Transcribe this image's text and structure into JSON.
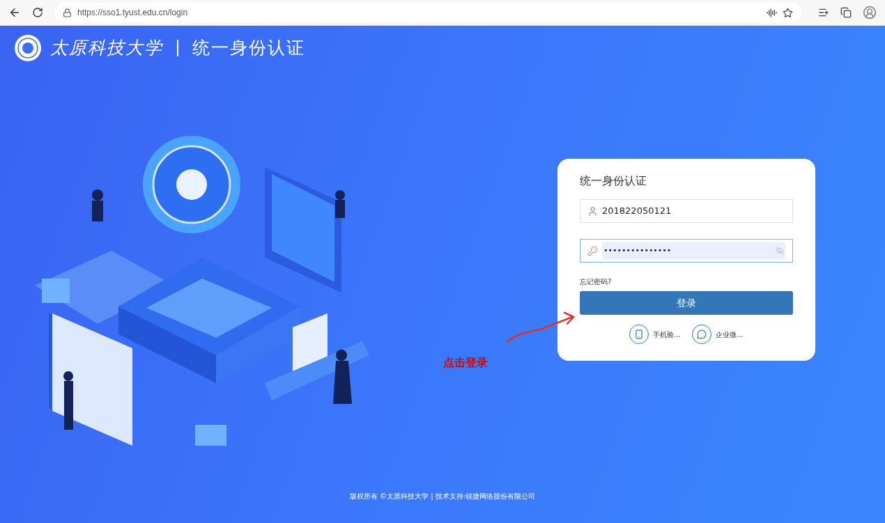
{
  "browser": {
    "url": "https://sso1.tyust.edu.cn/login"
  },
  "header": {
    "university_name": "太原科技大学",
    "system_title": "统一身份认证"
  },
  "login_card": {
    "title": "统一身份认证",
    "username": {
      "value": "201822050121"
    },
    "password": {
      "value": "•••••••••••••••",
      "focused": true
    },
    "forgot_link": "忘记密码?",
    "login_button": "登录",
    "alt_logins": [
      {
        "kind": "phone",
        "label": "手机验..."
      },
      {
        "kind": "wechat",
        "label": "企业微..."
      }
    ]
  },
  "annotation": {
    "text": "点击登录"
  },
  "footer": "版权所有 ©太原科技大学 | 技术支持:锐捷网络股份有限公司"
}
